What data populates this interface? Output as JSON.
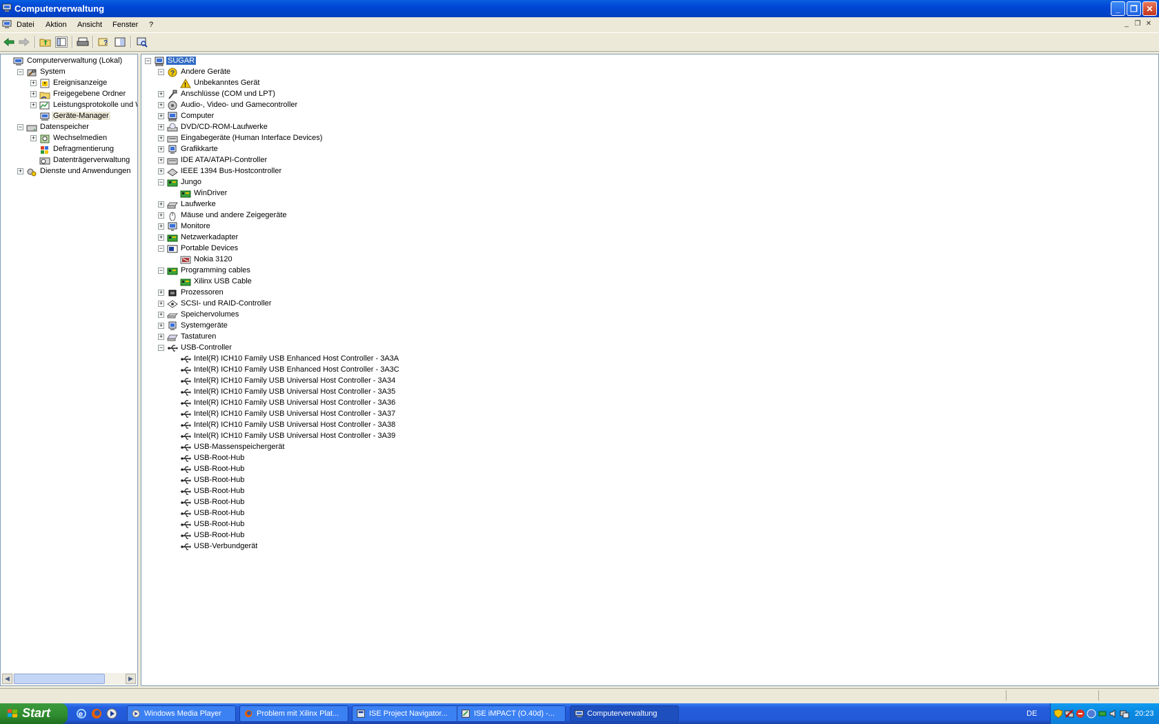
{
  "window": {
    "title": "Computerverwaltung"
  },
  "menu": [
    "Datei",
    "Aktion",
    "Ansicht",
    "Fenster",
    "?"
  ],
  "left_tree": [
    {
      "label": "Computerverwaltung (Lokal)",
      "level": 0,
      "expander": "none",
      "icon": "computer-management-icon"
    },
    {
      "label": "System",
      "level": 1,
      "expander": "minus",
      "icon": "system-tools-icon"
    },
    {
      "label": "Ereignisanzeige",
      "level": 2,
      "expander": "plus",
      "icon": "event-viewer-icon"
    },
    {
      "label": "Freigegebene Ordner",
      "level": 2,
      "expander": "plus",
      "icon": "shared-folders-icon"
    },
    {
      "label": "Leistungsprotokolle und Warnungen",
      "level": 2,
      "expander": "plus",
      "icon": "performance-logs-icon"
    },
    {
      "label": "Geräte-Manager",
      "level": 2,
      "expander": "none",
      "icon": "device-manager-icon",
      "selected": true
    },
    {
      "label": "Datenspeicher",
      "level": 1,
      "expander": "minus",
      "icon": "storage-icon"
    },
    {
      "label": "Wechselmedien",
      "level": 2,
      "expander": "plus",
      "icon": "removable-storage-icon"
    },
    {
      "label": "Defragmentierung",
      "level": 2,
      "expander": "none",
      "icon": "defrag-icon"
    },
    {
      "label": "Datenträgerverwaltung",
      "level": 2,
      "expander": "none",
      "icon": "disk-management-icon"
    },
    {
      "label": "Dienste und Anwendungen",
      "level": 1,
      "expander": "plus",
      "icon": "services-icon"
    }
  ],
  "device_tree": [
    {
      "label": "SUGAR",
      "level": 0,
      "expander": "minus",
      "icon": "computer-icon",
      "selected": true
    },
    {
      "label": "Andere Geräte",
      "level": 1,
      "expander": "minus",
      "icon": "unknown-device-icon"
    },
    {
      "label": "Unbekanntes Gerät",
      "level": 2,
      "expander": "none",
      "icon": "warning-device-icon"
    },
    {
      "label": "Anschlüsse (COM und LPT)",
      "level": 1,
      "expander": "plus",
      "icon": "port-icon"
    },
    {
      "label": "Audio-, Video- und Gamecontroller",
      "level": 1,
      "expander": "plus",
      "icon": "audio-icon"
    },
    {
      "label": "Computer",
      "level": 1,
      "expander": "plus",
      "icon": "computer-icon"
    },
    {
      "label": "DVD/CD-ROM-Laufwerke",
      "level": 1,
      "expander": "plus",
      "icon": "cdrom-icon"
    },
    {
      "label": "Eingabegeräte (Human Interface Devices)",
      "level": 1,
      "expander": "plus",
      "icon": "hid-icon"
    },
    {
      "label": "Grafikkarte",
      "level": 1,
      "expander": "plus",
      "icon": "display-adapter-icon"
    },
    {
      "label": "IDE ATA/ATAPI-Controller",
      "level": 1,
      "expander": "plus",
      "icon": "ide-icon"
    },
    {
      "label": "IEEE 1394 Bus-Hostcontroller",
      "level": 1,
      "expander": "plus",
      "icon": "firewire-icon"
    },
    {
      "label": "Jungo",
      "level": 1,
      "expander": "minus",
      "icon": "board-icon"
    },
    {
      "label": "WinDriver",
      "level": 2,
      "expander": "none",
      "icon": "board-icon"
    },
    {
      "label": "Laufwerke",
      "level": 1,
      "expander": "plus",
      "icon": "disk-drive-icon"
    },
    {
      "label": "Mäuse und andere Zeigegeräte",
      "level": 1,
      "expander": "plus",
      "icon": "mouse-icon"
    },
    {
      "label": "Monitore",
      "level": 1,
      "expander": "plus",
      "icon": "monitor-icon"
    },
    {
      "label": "Netzwerkadapter",
      "level": 1,
      "expander": "plus",
      "icon": "board-icon"
    },
    {
      "label": "Portable Devices",
      "level": 1,
      "expander": "minus",
      "icon": "portable-device-icon"
    },
    {
      "label": "Nokia 3120",
      "level": 2,
      "expander": "none",
      "icon": "phone-icon"
    },
    {
      "label": "Programming cables",
      "level": 1,
      "expander": "minus",
      "icon": "board-icon"
    },
    {
      "label": "Xilinx USB Cable",
      "level": 2,
      "expander": "none",
      "icon": "board-icon"
    },
    {
      "label": "Prozessoren",
      "level": 1,
      "expander": "plus",
      "icon": "processor-icon"
    },
    {
      "label": "SCSI- und RAID-Controller",
      "level": 1,
      "expander": "plus",
      "icon": "scsi-icon"
    },
    {
      "label": "Speichervolumes",
      "level": 1,
      "expander": "plus",
      "icon": "volume-icon"
    },
    {
      "label": "Systemgeräte",
      "level": 1,
      "expander": "plus",
      "icon": "system-device-icon"
    },
    {
      "label": "Tastaturen",
      "level": 1,
      "expander": "plus",
      "icon": "keyboard-icon"
    },
    {
      "label": "USB-Controller",
      "level": 1,
      "expander": "minus",
      "icon": "usb-icon"
    },
    {
      "label": "Intel(R) ICH10 Family USB Enhanced Host Controller - 3A3A",
      "level": 2,
      "expander": "none",
      "icon": "usb-icon"
    },
    {
      "label": "Intel(R) ICH10 Family USB Enhanced Host Controller - 3A3C",
      "level": 2,
      "expander": "none",
      "icon": "usb-icon"
    },
    {
      "label": "Intel(R) ICH10 Family USB Universal Host Controller - 3A34",
      "level": 2,
      "expander": "none",
      "icon": "usb-icon"
    },
    {
      "label": "Intel(R) ICH10 Family USB Universal Host Controller - 3A35",
      "level": 2,
      "expander": "none",
      "icon": "usb-icon"
    },
    {
      "label": "Intel(R) ICH10 Family USB Universal Host Controller - 3A36",
      "level": 2,
      "expander": "none",
      "icon": "usb-icon"
    },
    {
      "label": "Intel(R) ICH10 Family USB Universal Host Controller - 3A37",
      "level": 2,
      "expander": "none",
      "icon": "usb-icon"
    },
    {
      "label": "Intel(R) ICH10 Family USB Universal Host Controller - 3A38",
      "level": 2,
      "expander": "none",
      "icon": "usb-icon"
    },
    {
      "label": "Intel(R) ICH10 Family USB Universal Host Controller - 3A39",
      "level": 2,
      "expander": "none",
      "icon": "usb-icon"
    },
    {
      "label": "USB-Massenspeichergerät",
      "level": 2,
      "expander": "none",
      "icon": "usb-icon"
    },
    {
      "label": "USB-Root-Hub",
      "level": 2,
      "expander": "none",
      "icon": "usb-icon"
    },
    {
      "label": "USB-Root-Hub",
      "level": 2,
      "expander": "none",
      "icon": "usb-icon"
    },
    {
      "label": "USB-Root-Hub",
      "level": 2,
      "expander": "none",
      "icon": "usb-icon"
    },
    {
      "label": "USB-Root-Hub",
      "level": 2,
      "expander": "none",
      "icon": "usb-icon"
    },
    {
      "label": "USB-Root-Hub",
      "level": 2,
      "expander": "none",
      "icon": "usb-icon"
    },
    {
      "label": "USB-Root-Hub",
      "level": 2,
      "expander": "none",
      "icon": "usb-icon"
    },
    {
      "label": "USB-Root-Hub",
      "level": 2,
      "expander": "none",
      "icon": "usb-icon"
    },
    {
      "label": "USB-Root-Hub",
      "level": 2,
      "expander": "none",
      "icon": "usb-icon"
    },
    {
      "label": "USB-Verbundgerät",
      "level": 2,
      "expander": "none",
      "icon": "usb-icon"
    }
  ],
  "taskbar": {
    "start_label": "Start",
    "quicklaunch": [
      "ie-icon",
      "firefox-icon",
      "media-player-icon"
    ],
    "tasks": [
      {
        "label": "Windows Media Player",
        "icon": "media-player-icon",
        "active": false
      },
      {
        "label": "Problem mit Xilinx Plat...",
        "icon": "firefox-icon",
        "active": false
      },
      {
        "label": "ISE Project Navigator...",
        "icon": "ise-icon",
        "active": false
      },
      {
        "label": "ISE iMPACT (O.40d) -...",
        "icon": "impact-icon",
        "active": false
      },
      {
        "label": "Computerverwaltung",
        "icon": "computer-management-icon",
        "active": true
      }
    ],
    "language": "DE",
    "clock": "20:23"
  },
  "colors": {
    "selection": "#316AC5",
    "titlebar": "#0046D5",
    "taskbar": "#245EDC",
    "start": "#2F8B2F"
  }
}
